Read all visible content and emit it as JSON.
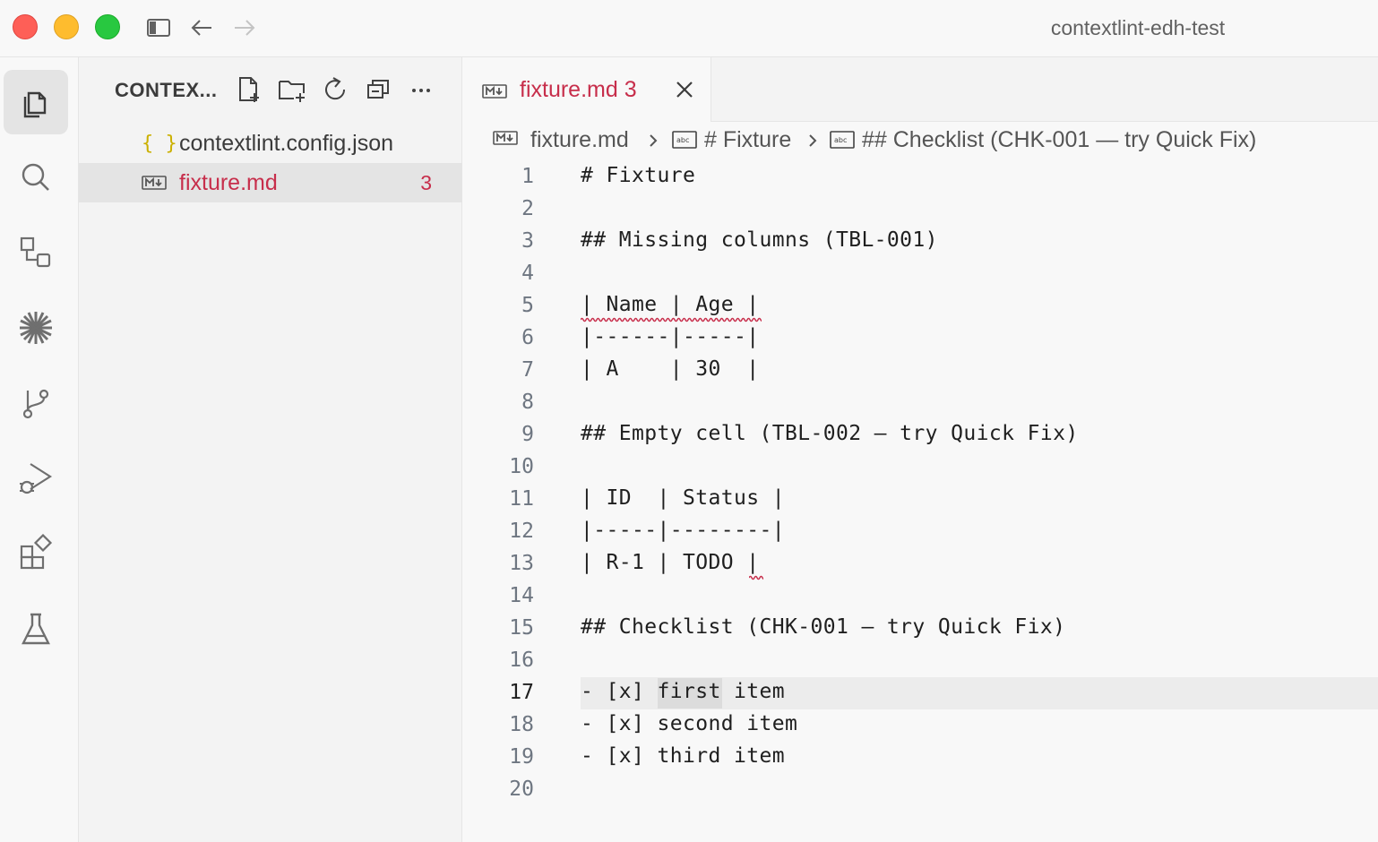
{
  "window": {
    "title": "contextlint-edh-test"
  },
  "activity_bar": {
    "items": [
      "explorer-icon",
      "search-icon",
      "remote-explorer-icon",
      "sparkle-icon",
      "source-control-icon",
      "run-debug-icon",
      "extensions-icon",
      "testing-icon"
    ],
    "active": "explorer-icon"
  },
  "explorer": {
    "title": "CONTEX...",
    "files": [
      {
        "icon": "{ }",
        "name": "contextlint.config.json",
        "badge": ""
      },
      {
        "icon": "M↓",
        "name": "fixture.md",
        "badge": "3"
      }
    ],
    "colors": {
      "json_icon": "#cbb000",
      "error": "#c72e4b"
    }
  },
  "tab": {
    "label": "fixture.md",
    "count": "3"
  },
  "breadcrumbs": {
    "file": "fixture.md",
    "section": "# Fixture",
    "subsection": "## Checklist (CHK-001 — try Quick Fix)"
  },
  "editor": {
    "current_line": 17,
    "lines": [
      {
        "n": "1",
        "text": "# Fixture"
      },
      {
        "n": "2",
        "text": ""
      },
      {
        "n": "3",
        "text": "## Missing columns (TBL-001)"
      },
      {
        "n": "4",
        "text": ""
      },
      {
        "n": "5",
        "text": "| Name | Age |"
      },
      {
        "n": "6",
        "text": "|------|-----|"
      },
      {
        "n": "7",
        "text": "| A    | 30  |"
      },
      {
        "n": "8",
        "text": ""
      },
      {
        "n": "9",
        "text": "## Empty cell (TBL-002 — try Quick Fix)"
      },
      {
        "n": "10",
        "text": ""
      },
      {
        "n": "11",
        "text": "| ID  | Status |"
      },
      {
        "n": "12",
        "text": "|-----|--------|"
      },
      {
        "n": "13",
        "text": "| R-1 | TODO |"
      },
      {
        "n": "14",
        "text": ""
      },
      {
        "n": "15",
        "text": "## Checklist (CHK-001 — try Quick Fix)"
      },
      {
        "n": "16",
        "text": ""
      },
      {
        "n": "17",
        "text": "- [x] first item"
      },
      {
        "n": "18",
        "text": "- [x] second item"
      },
      {
        "n": "19",
        "text": "- [x] third item"
      },
      {
        "n": "20",
        "text": ""
      }
    ]
  }
}
